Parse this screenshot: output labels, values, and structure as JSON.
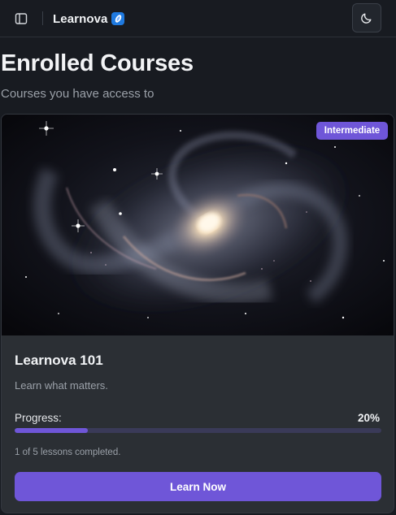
{
  "header": {
    "brand_name": "Learnova",
    "icons": {
      "sidebar_toggle": "panel-left-icon",
      "brand_logo": "learnova-logo-icon",
      "theme_toggle": "moon-icon"
    }
  },
  "page": {
    "title": "Enrolled Courses",
    "subtitle": "Courses you have access to"
  },
  "course": {
    "level_badge": "Intermediate",
    "title": "Learnova 101",
    "description": "Learn what matters.",
    "progress_label": "Progress:",
    "progress_text": "20%",
    "progress_fraction": 0.2,
    "lessons_text": "1 of 5 lessons completed.",
    "cta_label": "Learn Now"
  },
  "colors": {
    "background": "#181b21",
    "card": "#2b2f34",
    "accent": "#6f56d8",
    "progress_track": "#3a3a58"
  }
}
